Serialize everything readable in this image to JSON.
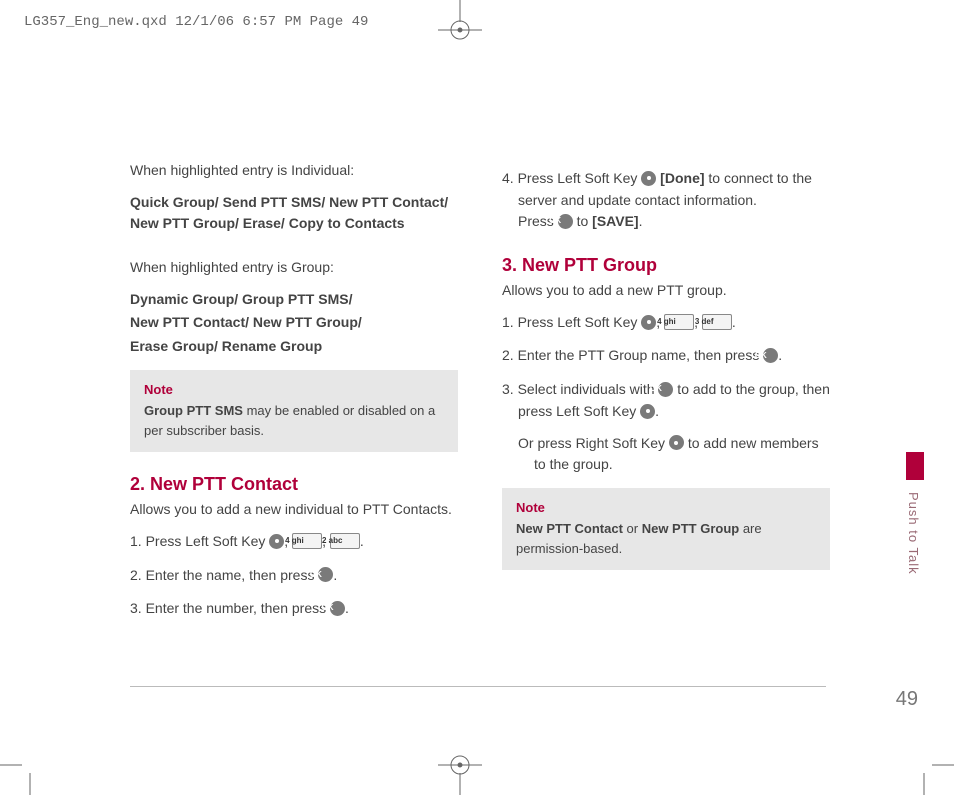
{
  "header": "LG357_Eng_new.qxd  12/1/06  6:57 PM  Page 49",
  "sidebar_label": "Push to Talk",
  "page_number": "49",
  "left": {
    "p1": "When highlighted entry is Individual:",
    "p2": "Quick Group/ Send PTT SMS/ New PTT Contact/ New PTT Group/ Erase/ Copy to Contacts",
    "p3": "When highlighted entry is Group:",
    "p4a": "Dynamic Group/ Group PTT SMS/",
    "p4b": "New PTT Contact/ New PTT Group/",
    "p4c": "Erase Group/ Rename Group",
    "note_title": "Note",
    "note_body_b": "Group PTT SMS",
    "note_body_rest": " may be enabled or disabled on a per subscriber basis.",
    "sec2_title": "2. New PTT Contact",
    "sec2_sub": "Allows you to add a new individual to PTT Contacts.",
    "s2_1a": "1. Press Left Soft Key ",
    "s2_1b": ", ",
    "s2_1c": ", ",
    "s2_1d": ".",
    "s2_2a": "2. Enter the name, then press ",
    "s2_2b": ".",
    "s2_3a": "3. Enter the number, then press ",
    "s2_3b": ".",
    "key_4ghi": "4 ghi",
    "key_2abc": "2 abc",
    "key_3def": "3 def",
    "ok": "OK"
  },
  "right": {
    "s4a": "4. Press Left Soft Key ",
    "s4b": " [Done]",
    "s4c": " to connect to the server and update contact information.",
    "s4d": "Press ",
    "s4e": " to ",
    "s4f": "[SAVE]",
    "s4g": ".",
    "sec3_title": "3. New PTT Group",
    "sec3_sub": "Allows you to add a new PTT group.",
    "s3_1a": "1. Press Left Soft Key ",
    "s3_1b": ", ",
    "s3_1c": ", ",
    "s3_1d": ".",
    "s3_2a": "2. Enter the PTT Group name, then press ",
    "s3_2b": ".",
    "s3_3a": "3. Select individuals with ",
    "s3_3b": " to add to the group, then press Left Soft Key ",
    "s3_3c": ".",
    "s3_or_a": "Or press Right Soft Key ",
    "s3_or_b": " to add new members to the group.",
    "note_title": "Note",
    "note_b1": "New PTT Contact",
    "note_mid": " or ",
    "note_b2": "New PTT Group",
    "note_rest": " are permission-based."
  }
}
